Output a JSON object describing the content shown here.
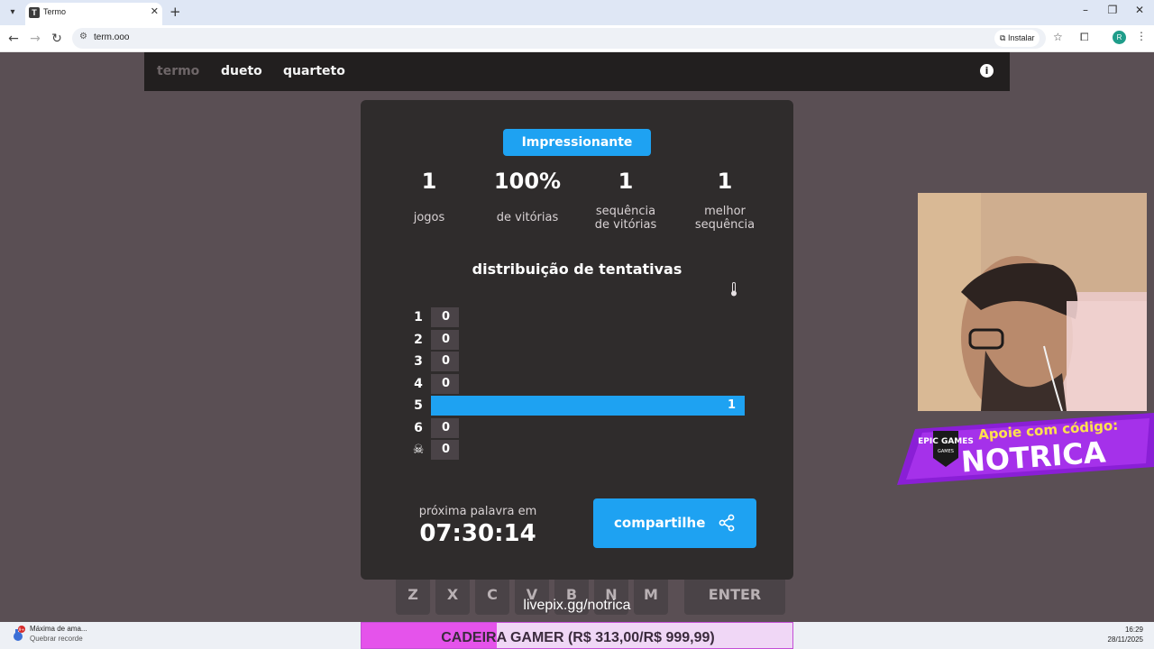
{
  "browser": {
    "tab_title": "Termo",
    "tab_favicon": "T",
    "new_tab": "+",
    "url": "term.ooo",
    "install_label": "Instalar",
    "profile_initial": "R"
  },
  "game": {
    "modes": [
      "termo",
      "dueto",
      "quarteto"
    ],
    "active_mode": "termo",
    "keyboard": [
      "Z",
      "X",
      "C",
      "V",
      "B",
      "N",
      "M"
    ],
    "enter_label": "ENTER"
  },
  "stats": {
    "badge": "Impressionante",
    "items": [
      {
        "value": "1",
        "label_line1": "",
        "label_line2": "jogos"
      },
      {
        "value": "100%",
        "label_line1": "",
        "label_line2": "de vitórias"
      },
      {
        "value": "1",
        "label_line1": "sequência",
        "label_line2": "de vitórias"
      },
      {
        "value": "1",
        "label_line1": "melhor",
        "label_line2": "sequência"
      }
    ],
    "distribution_title": "distribuição de tentativas",
    "distribution": [
      {
        "label": "1",
        "count": 0
      },
      {
        "label": "2",
        "count": 0
      },
      {
        "label": "3",
        "count": 0
      },
      {
        "label": "4",
        "count": 0
      },
      {
        "label": "5",
        "count": 1
      },
      {
        "label": "6",
        "count": 0
      },
      {
        "label": "skull",
        "count": 0
      }
    ],
    "next_word_label": "próxima palavra em",
    "countdown": "07:30:14",
    "share_label": "compartilhe"
  },
  "overlay": {
    "livepix": "livepix.gg/notrica",
    "sponsor_top": "Apoie com código:",
    "sponsor_code": "NOTRICA",
    "epic_logo": "EPIC GAMES",
    "goal_text": "CADEIRA GAMER (R$ 313,00/R$ 999,99)",
    "goal_progress": 0.313
  },
  "taskbar": {
    "notif_badge": "9+",
    "notif_title": "Máxima de ama...",
    "notif_sub": "Quebrar recorde",
    "time": "16:29",
    "date": "28/11/2025"
  },
  "colors": {
    "accent": "#1ea2f2",
    "modal_bg": "#2f2c2c",
    "page_bg": "#5a4f54"
  }
}
